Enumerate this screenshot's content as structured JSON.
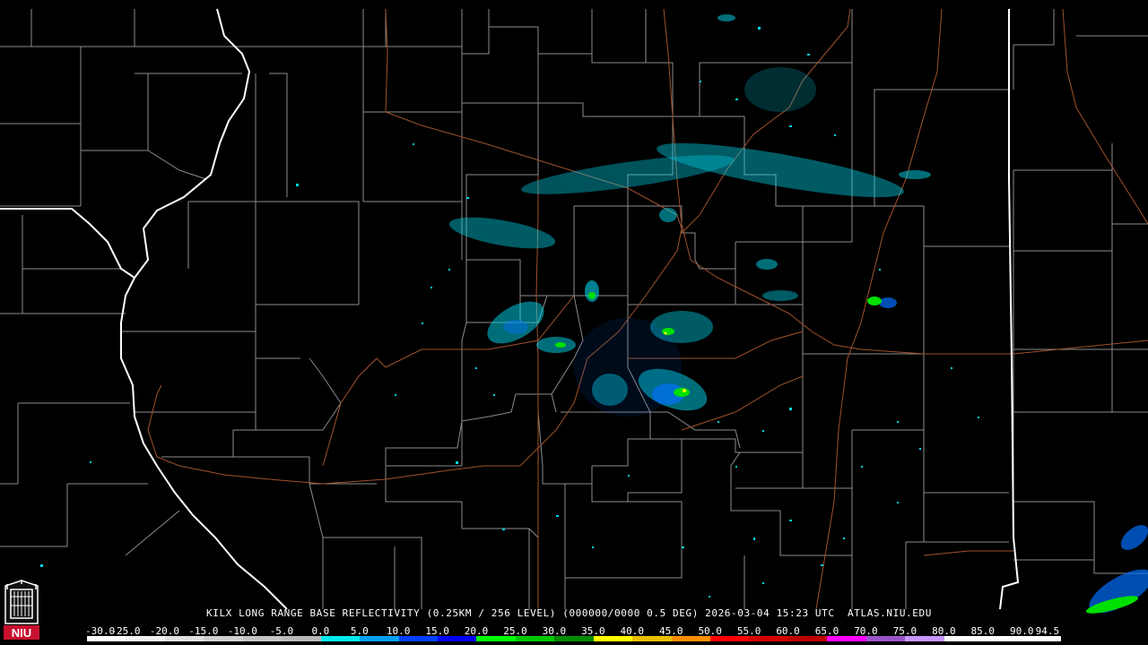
{
  "product": {
    "caption": "KILX LONG RANGE BASE REFLECTIVITY (0.25KM / 256 LEVEL) (000000/0000 0.5 DEG) 2026-03-04 15:23 UTC  ATLAS.NIU.EDU"
  },
  "logo": {
    "text": "NIU",
    "bg": "#c8102e"
  },
  "colors": {
    "background": "#000000",
    "county_lines": "#9a9a9a",
    "state_lines": "#ffffff",
    "roads": "#a0522d"
  },
  "scale": {
    "labels": [
      "-30.0",
      "-25.0",
      "-20.0",
      "-15.0",
      "-10.0",
      "-5.0",
      "0.0",
      "5.0",
      "10.0",
      "15.0",
      "20.0",
      "25.0",
      "30.0",
      "35.0",
      "40.0",
      "45.0",
      "50.0",
      "55.0",
      "60.0",
      "65.0",
      "70.0",
      "75.0",
      "80.0",
      "85.0",
      "90.0",
      "94.5"
    ],
    "colors": [
      "#ffffff",
      "#f2f2f2",
      "#e0e0e0",
      "#d0d0d0",
      "#c4c4c4",
      "#b8b8b8",
      "#00ecec",
      "#01a0f6",
      "#0040ff",
      "#0000f6",
      "#00ff00",
      "#00c800",
      "#008c00",
      "#ffff00",
      "#e7c000",
      "#ff9000",
      "#ff0000",
      "#d60000",
      "#c00000",
      "#ff00ff",
      "#9955c9",
      "#c896ff",
      "#ffffff",
      "#ffffff",
      "#ffffff"
    ]
  }
}
